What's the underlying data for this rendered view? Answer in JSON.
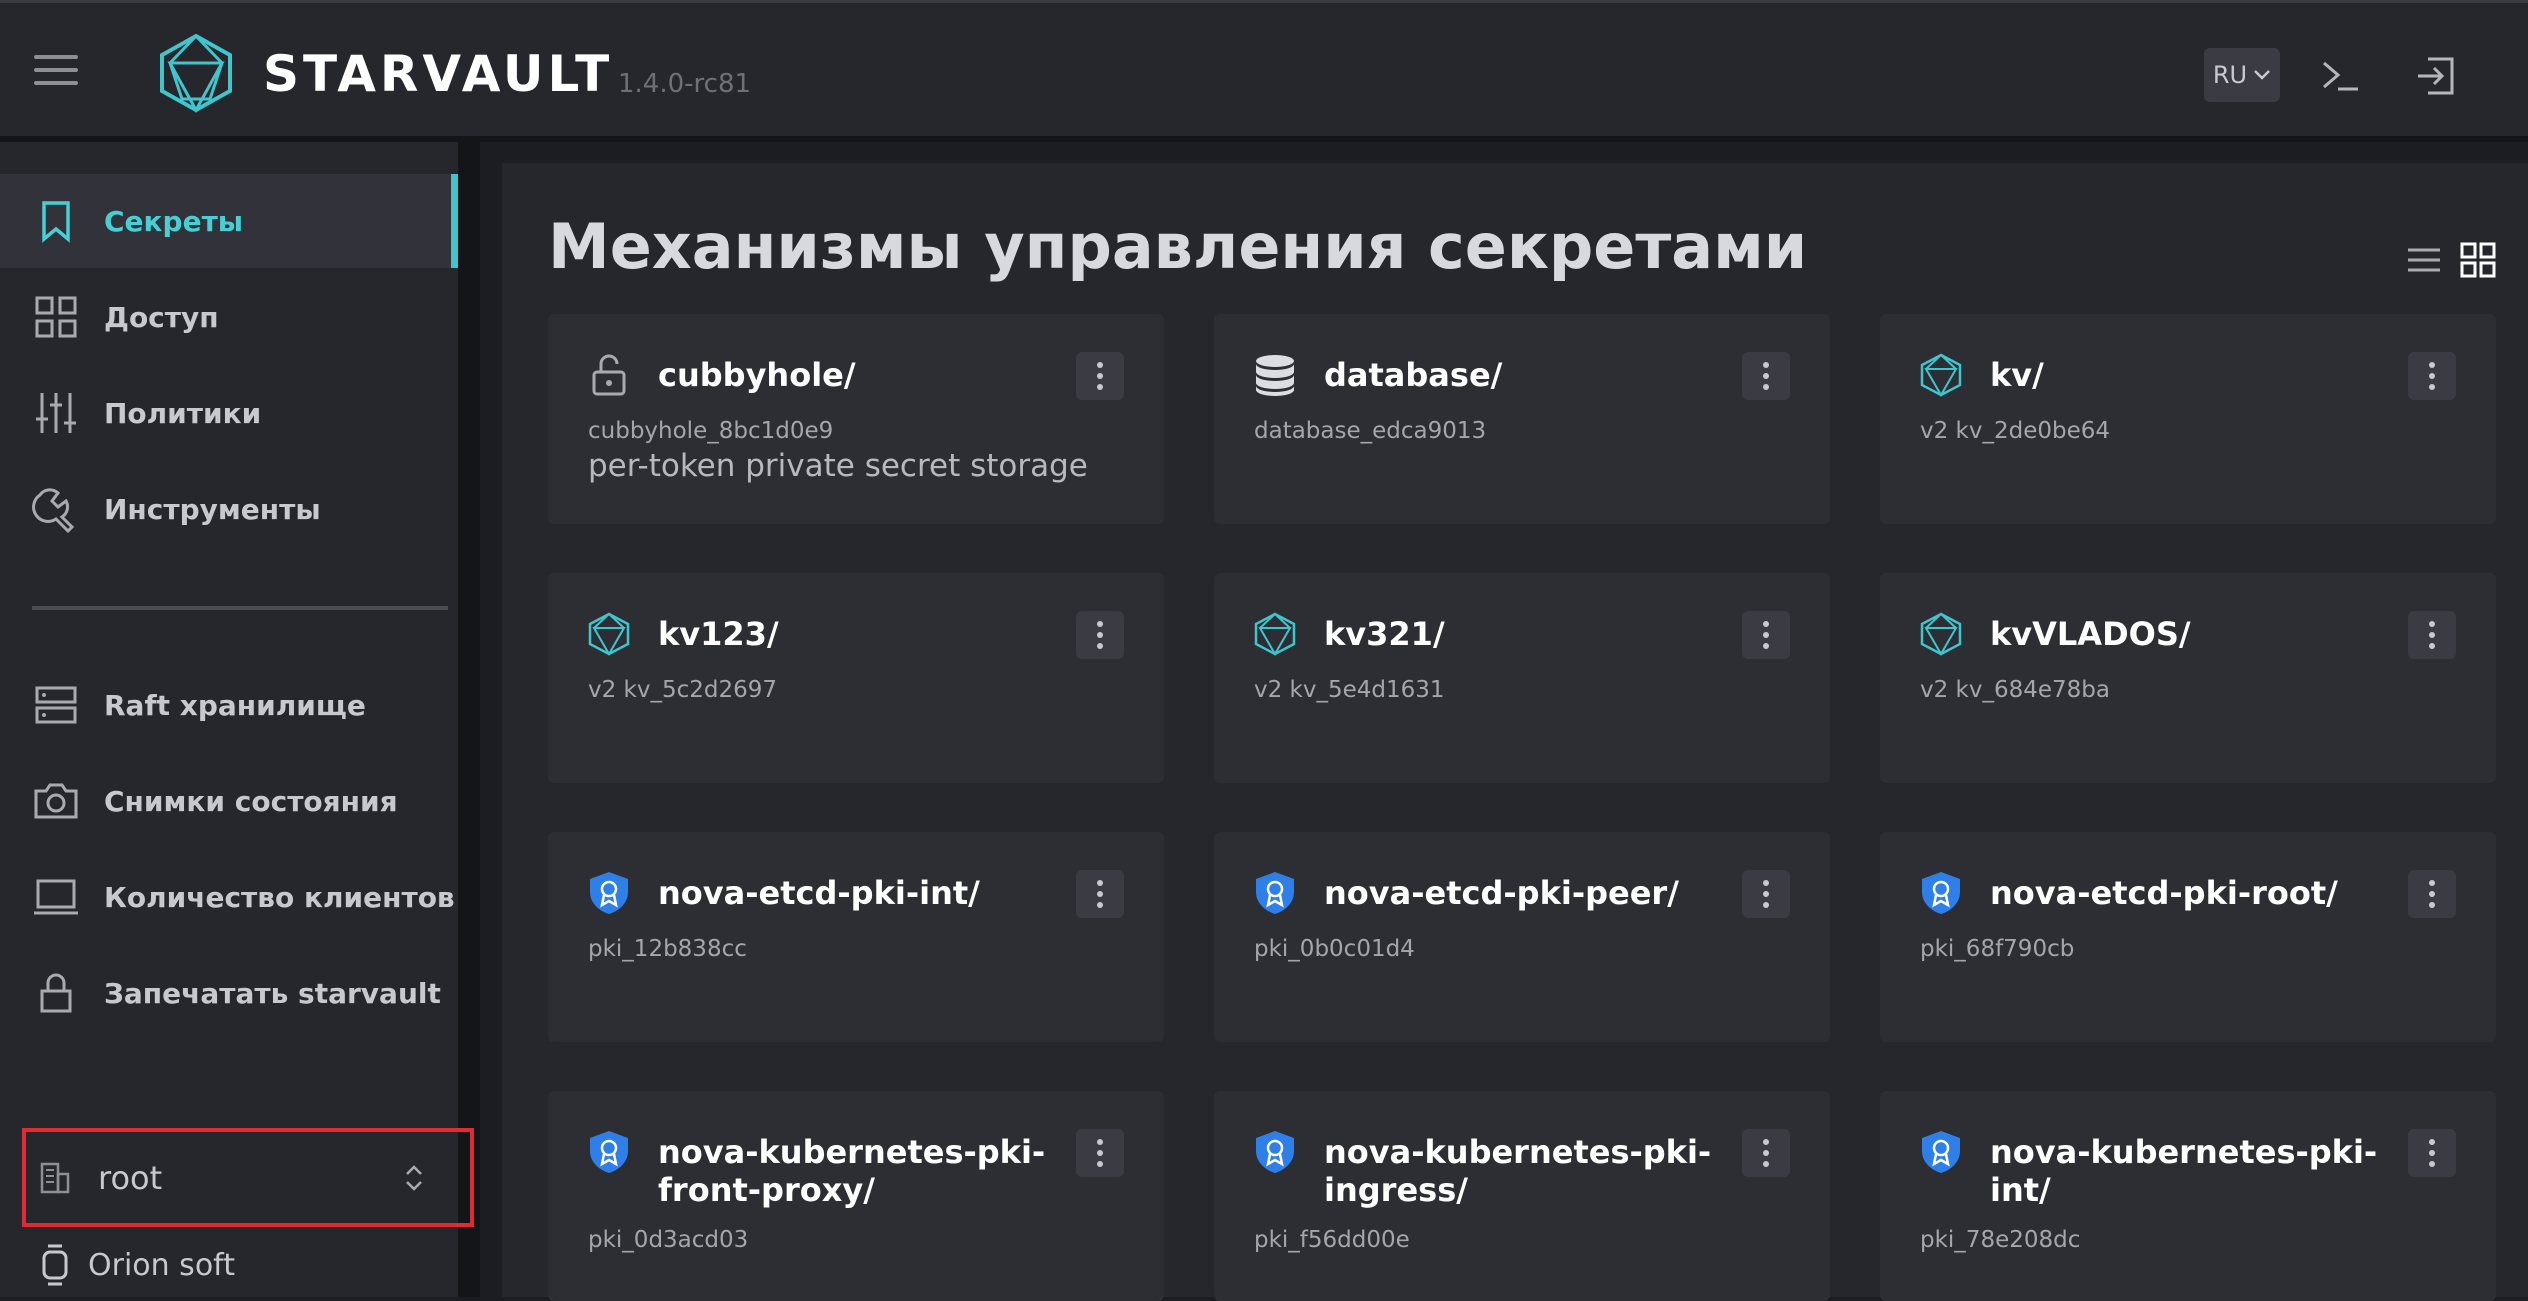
{
  "app": {
    "logo": "STARVAULT",
    "version": "1.4.0-rc81"
  },
  "header": {
    "lang": "RU"
  },
  "sidebar": {
    "items": [
      {
        "label": "Секреты"
      },
      {
        "label": "Доступ"
      },
      {
        "label": "Политики"
      },
      {
        "label": "Инструменты"
      },
      {
        "label": "Raft хранилище"
      },
      {
        "label": "Снимки состояния"
      },
      {
        "label": "Количество клиентов"
      },
      {
        "label": "Запечатать starvault"
      }
    ],
    "namespace": "root",
    "org": "Orion soft"
  },
  "main": {
    "title": "Механизмы управления секретами",
    "cards": [
      {
        "title": "cubbyhole/",
        "sub": "cubbyhole_8bc1d0e9",
        "desc": "per-token private secret storage"
      },
      {
        "title": "database/",
        "sub": "database_edca9013"
      },
      {
        "title": "kv/",
        "sub": "v2 kv_2de0be64"
      },
      {
        "title": "kv123/",
        "sub": "v2 kv_5c2d2697"
      },
      {
        "title": "kv321/",
        "sub": "v2 kv_5e4d1631"
      },
      {
        "title": "kvVLADOS/",
        "sub": "v2 kv_684e78ba"
      },
      {
        "title": "nova-etcd-pki-int/",
        "sub": "pki_12b838cc"
      },
      {
        "title": "nova-etcd-pki-peer/",
        "sub": "pki_0b0c01d4"
      },
      {
        "title": "nova-etcd-pki-root/",
        "sub": "pki_68f790cb"
      },
      {
        "title": "nova-kubernetes-pki-front-proxy/",
        "sub": "pki_0d3acd03"
      },
      {
        "title": "nova-kubernetes-pki-ingress/",
        "sub": "pki_f56dd00e"
      },
      {
        "title": "nova-kubernetes-pki-int/",
        "sub": "pki_78e208dc"
      }
    ]
  },
  "colors": {
    "accent": "#3fc6cd",
    "pki_badge": "#2f7fe8",
    "highlight": "#e02b35"
  }
}
